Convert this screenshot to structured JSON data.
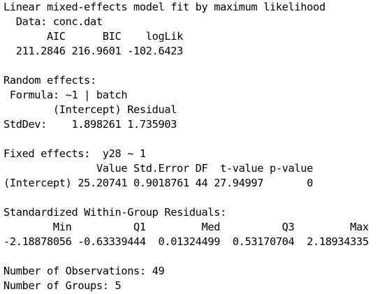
{
  "output": {
    "lines": [
      "Linear mixed-effects model fit by maximum likelihood",
      "  Data: conc.dat",
      "       AIC      BIC    logLik",
      "  211.2846 216.9601 -102.6423",
      "",
      "Random effects:",
      " Formula: ~1 | batch",
      "        (Intercept) Residual",
      "StdDev:    1.898261 1.735903",
      "",
      "Fixed effects:  y28 ~ 1",
      "               Value Std.Error DF  t-value p-value",
      "(Intercept) 25.20741 0.9018761 44 27.94997       0",
      "",
      "Standardized Within-Group Residuals:",
      "        Min          Q1         Med          Q3         Max",
      "-2.18878056 -0.63339444  0.01324499  0.53170704  2.18934335",
      "",
      "Number of Observations: 49",
      "Number of Groups: 5"
    ]
  }
}
